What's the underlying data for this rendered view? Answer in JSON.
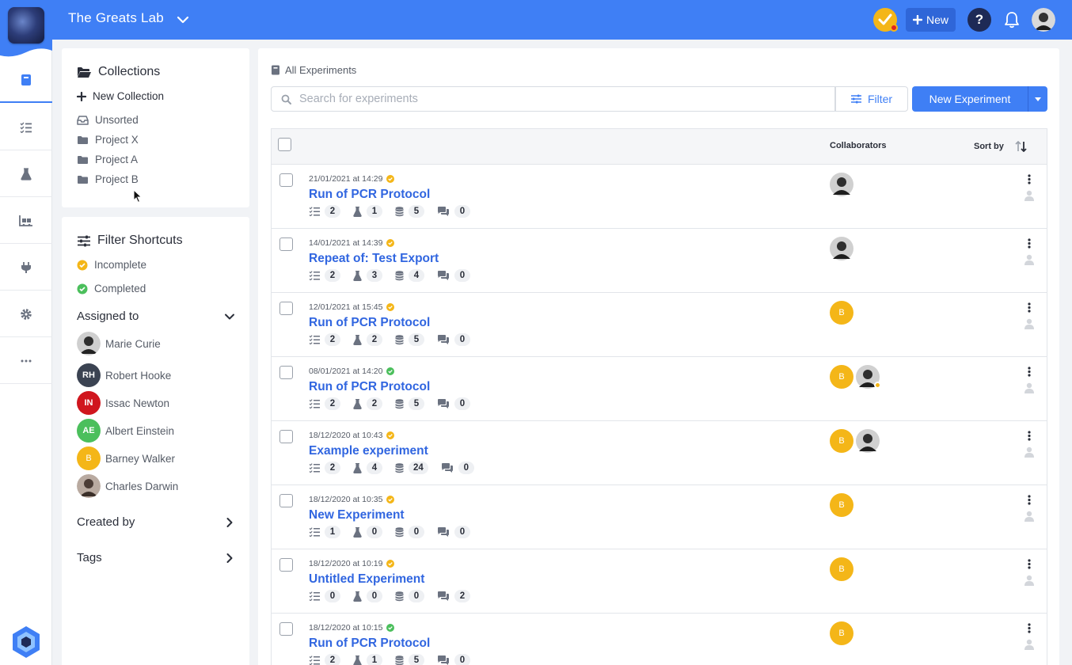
{
  "header": {
    "lab_name": "The Greats Lab",
    "new_label": "New",
    "help_label": "?"
  },
  "rail": {
    "items": [
      "experiments-icon",
      "protocols-icon",
      "samples-icon",
      "inventory-icon",
      "integrations-icon",
      "settings-icon",
      "more-icon"
    ]
  },
  "collections": {
    "title": "Collections",
    "new_label": "New Collection",
    "items": [
      "Unsorted",
      "Project X",
      "Project A",
      "Project B"
    ]
  },
  "filters": {
    "title": "Filter Shortcuts",
    "statuses": [
      {
        "label": "Incomplete",
        "color": "#f4b618"
      },
      {
        "label": "Completed",
        "color": "#4bbf5c"
      }
    ],
    "assigned_to": "Assigned to",
    "people": [
      {
        "name": "Marie Curie",
        "initials": "",
        "color": "#2a2a2a"
      },
      {
        "name": "Robert Hooke",
        "initials": "RH",
        "color": "#3b4352"
      },
      {
        "name": "Issac Newton",
        "initials": "IN",
        "color": "#d0161e"
      },
      {
        "name": "Albert Einstein",
        "initials": "AE",
        "color": "#4bbf5c"
      },
      {
        "name": "Barney Walker",
        "initials": "B",
        "color": "#f4b618"
      },
      {
        "name": "Charles Darwin",
        "initials": "",
        "color": "#5a4a42"
      }
    ],
    "created_by": "Created by",
    "tags": "Tags"
  },
  "main": {
    "breadcrumb": "All Experiments",
    "search_placeholder": "Search for experiments",
    "filter_label": "Filter",
    "new_experiment_label": "New Experiment",
    "col_collaborators": "Collaborators",
    "col_sort": "Sort by"
  },
  "experiments": [
    {
      "date": "21/01/2021 at 14:29",
      "status": "incomplete",
      "title": "Run of PCR Protocol",
      "steps": "2",
      "samples": "1",
      "data": "5",
      "comments": "0",
      "collaborators": [
        "photo"
      ]
    },
    {
      "date": "14/01/2021 at 14:39",
      "status": "incomplete",
      "title": "Repeat of: Test Export",
      "steps": "2",
      "samples": "3",
      "data": "4",
      "comments": "0",
      "collaborators": [
        "photo"
      ]
    },
    {
      "date": "12/01/2021 at 15:45",
      "status": "incomplete",
      "title": "Run of PCR Protocol",
      "steps": "2",
      "samples": "2",
      "data": "5",
      "comments": "0",
      "collaborators": [
        "B"
      ]
    },
    {
      "date": "08/01/2021 at 14:20",
      "status": "complete",
      "title": "Run of PCR Protocol",
      "steps": "2",
      "samples": "2",
      "data": "5",
      "comments": "0",
      "collaborators": [
        "B",
        "photo-online"
      ]
    },
    {
      "date": "18/12/2020 at 10:43",
      "status": "incomplete",
      "title": "Example experiment",
      "steps": "2",
      "samples": "4",
      "data": "24",
      "comments": "0",
      "collaborators": [
        "B",
        "photo"
      ]
    },
    {
      "date": "18/12/2020 at 10:35",
      "status": "incomplete",
      "title": "New Experiment",
      "steps": "1",
      "samples": "0",
      "data": "0",
      "comments": "0",
      "collaborators": [
        "B"
      ]
    },
    {
      "date": "18/12/2020 at 10:19",
      "status": "incomplete",
      "title": "Untitled Experiment",
      "steps": "0",
      "samples": "0",
      "data": "0",
      "comments": "2",
      "collaborators": [
        "B"
      ]
    },
    {
      "date": "18/12/2020 at 10:15",
      "status": "complete",
      "title": "Run of PCR Protocol",
      "steps": "2",
      "samples": "1",
      "data": "5",
      "comments": "0",
      "collaborators": [
        "B"
      ]
    }
  ],
  "colors": {
    "primary": "#3f7ff5",
    "incomplete": "#f4b618",
    "complete": "#4bbf5c"
  }
}
